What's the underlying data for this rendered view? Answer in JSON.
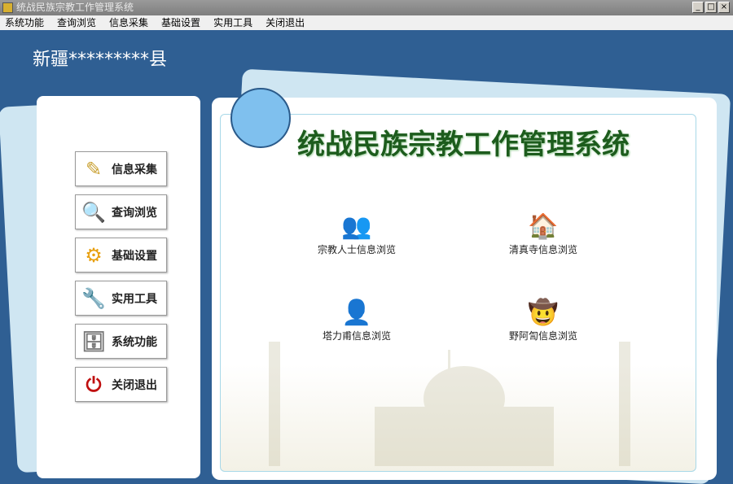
{
  "window": {
    "title": "统战民族宗教工作管理系统",
    "min": "_",
    "max": "□",
    "close": "×"
  },
  "menu": [
    "系统功能",
    "查询浏览",
    "信息采集",
    "基础设置",
    "实用工具",
    "关闭退出"
  ],
  "county": "新疆*********县",
  "app_title": "统战民族宗教工作管理系统",
  "nav": [
    {
      "label": "信息采集",
      "icon": "✎"
    },
    {
      "label": "查询浏览",
      "icon": "🔍"
    },
    {
      "label": "基础设置",
      "icon": "⚙"
    },
    {
      "label": "实用工具",
      "icon": "🔧"
    },
    {
      "label": "系统功能",
      "icon": "🗄"
    },
    {
      "label": "关闭退出",
      "icon": "⏻"
    }
  ],
  "tiles": [
    {
      "label": "宗教人士信息浏览",
      "icon": "👥"
    },
    {
      "label": "清真寺信息浏览",
      "icon": "🏠"
    },
    {
      "label": "塔力甫信息浏览",
      "icon": "👤"
    },
    {
      "label": "野阿訇信息浏览",
      "icon": "🤠"
    }
  ]
}
